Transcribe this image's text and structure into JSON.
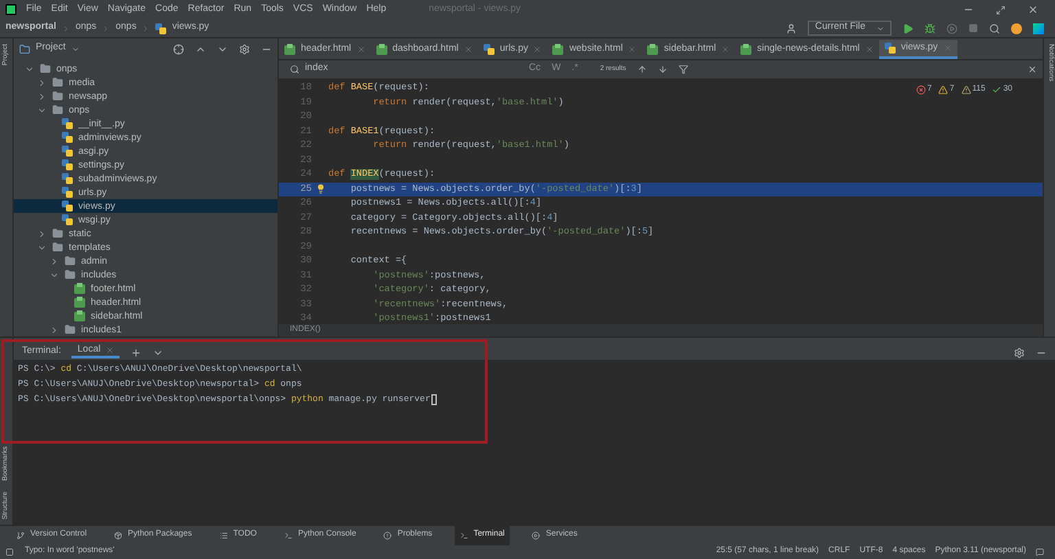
{
  "menu": [
    "File",
    "Edit",
    "View",
    "Navigate",
    "Code",
    "Refactor",
    "Run",
    "Tools",
    "VCS",
    "Window",
    "Help"
  ],
  "window": {
    "title": "newsportal - views.py"
  },
  "breadcrumb": [
    {
      "label": "newsportal",
      "kind": "project"
    },
    {
      "label": "onps",
      "kind": "folder"
    },
    {
      "label": "onps",
      "kind": "folder"
    },
    {
      "label": "views.py",
      "kind": "python"
    }
  ],
  "run_config": "Current File",
  "project_panel": {
    "title": "Project"
  },
  "editor_tabs": [
    {
      "label": "header.html",
      "kind": "html",
      "selected": false
    },
    {
      "label": "dashboard.html",
      "kind": "html",
      "selected": false
    },
    {
      "label": "urls.py",
      "kind": "python",
      "selected": false
    },
    {
      "label": "website.html",
      "kind": "html",
      "selected": false
    },
    {
      "label": "sidebar.html",
      "kind": "html",
      "selected": false
    },
    {
      "label": "single-news-details.html",
      "kind": "html",
      "selected": false
    },
    {
      "label": "views.py",
      "kind": "python",
      "selected": true
    }
  ],
  "find_bar": {
    "value": "index",
    "results": "2 results",
    "options": [
      "Cc",
      "W",
      ".*"
    ]
  },
  "tree": [
    {
      "label": "onps",
      "kind": "folder",
      "expanded": true,
      "selected": false,
      "children": [
        {
          "label": "media",
          "kind": "folder",
          "expanded": false,
          "selected": false
        },
        {
          "label": "newsapp",
          "kind": "folder",
          "expanded": false,
          "selected": false
        },
        {
          "label": "onps",
          "kind": "folder",
          "expanded": true,
          "selected": false,
          "children": [
            {
              "label": "__init__.py",
              "kind": "python",
              "selected": false
            },
            {
              "label": "adminviews.py",
              "kind": "python",
              "selected": false
            },
            {
              "label": "asgi.py",
              "kind": "python",
              "selected": false
            },
            {
              "label": "settings.py",
              "kind": "python",
              "selected": false
            },
            {
              "label": "subadminviews.py",
              "kind": "python",
              "selected": false
            },
            {
              "label": "urls.py",
              "kind": "python",
              "selected": false
            },
            {
              "label": "views.py",
              "kind": "python",
              "selected": true
            },
            {
              "label": "wsgi.py",
              "kind": "python",
              "selected": false
            }
          ]
        },
        {
          "label": "static",
          "kind": "folder",
          "expanded": false,
          "selected": false
        },
        {
          "label": "templates",
          "kind": "folder",
          "expanded": true,
          "selected": false,
          "children": [
            {
              "label": "admin",
              "kind": "folder",
              "expanded": false,
              "selected": false
            },
            {
              "label": "includes",
              "kind": "folder",
              "expanded": true,
              "selected": false,
              "children": [
                {
                  "label": "footer.html",
                  "kind": "html",
                  "selected": false
                },
                {
                  "label": "header.html",
                  "kind": "html",
                  "selected": false
                },
                {
                  "label": "sidebar.html",
                  "kind": "html",
                  "selected": false
                }
              ]
            },
            {
              "label": "includes1",
              "kind": "folder",
              "expanded": false,
              "selected": false
            }
          ]
        }
      ]
    }
  ],
  "inspections": [
    {
      "kind": "error",
      "count": "7"
    },
    {
      "kind": "warning",
      "count": "7"
    },
    {
      "kind": "weak",
      "count": "115"
    },
    {
      "kind": "typo",
      "count": "30"
    }
  ],
  "code": [
    {
      "number": "18",
      "selected": false,
      "tokens": [
        {
          "text": "def ",
          "kind": "keyword"
        },
        {
          "text": "BASE",
          "kind": "func"
        },
        {
          "text": "(request):",
          "kind": "plain"
        }
      ]
    },
    {
      "number": "19",
      "selected": false,
      "tokens": [
        {
          "text": "        return ",
          "kind": "keyword"
        },
        {
          "text": "render(request,",
          "kind": "plain"
        },
        {
          "text": "'base.html'",
          "kind": "string"
        },
        {
          "text": ")",
          "kind": "plain"
        }
      ]
    },
    {
      "number": "20",
      "selected": false
    },
    {
      "number": "21",
      "selected": false,
      "tokens": [
        {
          "text": "def ",
          "kind": "keyword"
        },
        {
          "text": "BASE1",
          "kind": "func"
        },
        {
          "text": "(request):",
          "kind": "plain"
        }
      ]
    },
    {
      "number": "22",
      "selected": false,
      "tokens": [
        {
          "text": "        return ",
          "kind": "keyword"
        },
        {
          "text": "render(request,",
          "kind": "plain"
        },
        {
          "text": "'base1.html'",
          "kind": "string"
        },
        {
          "text": ")",
          "kind": "plain"
        }
      ]
    },
    {
      "number": "23",
      "selected": false
    },
    {
      "number": "24",
      "selected": false,
      "tokens": [
        {
          "text": "def ",
          "kind": "keyword"
        },
        {
          "text": "INDEX",
          "kind": "match"
        },
        {
          "text": "(request):",
          "kind": "plain"
        }
      ]
    },
    {
      "number": "25",
      "selected": true,
      "tokens": [
        {
          "text": "    postnews = News.objects.order_by(",
          "kind": "plain"
        },
        {
          "text": "'-posted_date'",
          "kind": "string"
        },
        {
          "text": ")[:",
          "kind": "plain"
        },
        {
          "text": "3",
          "kind": "number"
        },
        {
          "text": "]",
          "kind": "plain"
        }
      ]
    },
    {
      "number": "26",
      "selected": false,
      "tokens": [
        {
          "text": "    postnews1 = News.objects.all()[:",
          "kind": "plain"
        },
        {
          "text": "4",
          "kind": "number"
        },
        {
          "text": "]",
          "kind": "plain"
        }
      ]
    },
    {
      "number": "27",
      "selected": false,
      "tokens": [
        {
          "text": "    category = Category.objects.all()[:",
          "kind": "plain"
        },
        {
          "text": "4",
          "kind": "number"
        },
        {
          "text": "]",
          "kind": "plain"
        }
      ]
    },
    {
      "number": "28",
      "selected": false,
      "tokens": [
        {
          "text": "    recentnews = News.objects.order_by(",
          "kind": "plain"
        },
        {
          "text": "'-posted_date'",
          "kind": "string"
        },
        {
          "text": ")[:",
          "kind": "plain"
        },
        {
          "text": "5",
          "kind": "number"
        },
        {
          "text": "]",
          "kind": "plain"
        }
      ]
    },
    {
      "number": "29",
      "selected": false
    },
    {
      "number": "30",
      "selected": false,
      "tokens": [
        {
          "text": "    context ={",
          "kind": "plain"
        }
      ]
    },
    {
      "number": "31",
      "selected": false,
      "tokens": [
        {
          "text": "        'postnews'",
          "kind": "string"
        },
        {
          "text": ":postnews,",
          "kind": "plain"
        }
      ]
    },
    {
      "number": "32",
      "selected": false,
      "tokens": [
        {
          "text": "        'category'",
          "kind": "string"
        },
        {
          "text": ": category,",
          "kind": "plain"
        }
      ]
    },
    {
      "number": "33",
      "selected": false,
      "tokens": [
        {
          "text": "        'recentnews'",
          "kind": "string"
        },
        {
          "text": ":recentnews,",
          "kind": "plain"
        }
      ]
    },
    {
      "number": "34",
      "selected": false,
      "tokens": [
        {
          "text": "        'postnews1'",
          "kind": "string"
        },
        {
          "text": ":postnews1",
          "kind": "plain"
        }
      ]
    }
  ],
  "editor_breadcrumb": "INDEX()",
  "terminal": {
    "title": "Terminal:",
    "tabs": [
      {
        "label": "Local",
        "selected": true
      }
    ],
    "lines": [
      [
        {
          "text": "PS C:\\> ",
          "kind": "plain"
        },
        {
          "text": "cd",
          "kind": "command"
        },
        {
          "text": " C:\\Users\\ANUJ\\OneDrive\\Desktop\\newsportal\\",
          "kind": "plain"
        }
      ],
      [
        {
          "text": "PS C:\\Users\\ANUJ\\OneDrive\\Desktop\\newsportal> ",
          "kind": "plain"
        },
        {
          "text": "cd",
          "kind": "command"
        },
        {
          "text": " onps",
          "kind": "plain"
        }
      ],
      [
        {
          "text": "PS C:\\Users\\ANUJ\\OneDrive\\Desktop\\newsportal\\onps> ",
          "kind": "plain"
        },
        {
          "text": "python",
          "kind": "command"
        },
        {
          "text": " manage.py runserver",
          "kind": "plain"
        }
      ]
    ]
  },
  "left_stripe_top": [
    {
      "label": "Project"
    }
  ],
  "left_stripe_bottom": [
    {
      "label": "Bookmarks"
    },
    {
      "label": "Structure"
    }
  ],
  "right_stripe": [
    {
      "label": "Notifications"
    }
  ],
  "tool_windows": [
    {
      "label": "Version Control",
      "selected": false
    },
    {
      "label": "Python Packages",
      "selected": false
    },
    {
      "label": "TODO",
      "selected": false
    },
    {
      "label": "Python Console",
      "selected": false
    },
    {
      "label": "Problems",
      "selected": false
    },
    {
      "label": "Terminal",
      "selected": true
    },
    {
      "label": "Services",
      "selected": false
    }
  ],
  "status_bar": {
    "message": "Typo: In word 'postnews'",
    "items": [
      "25:5 (57 chars, 1 line break)",
      "CRLF",
      "UTF-8",
      "4 spaces",
      "Python 3.11 (newsportal)"
    ]
  }
}
